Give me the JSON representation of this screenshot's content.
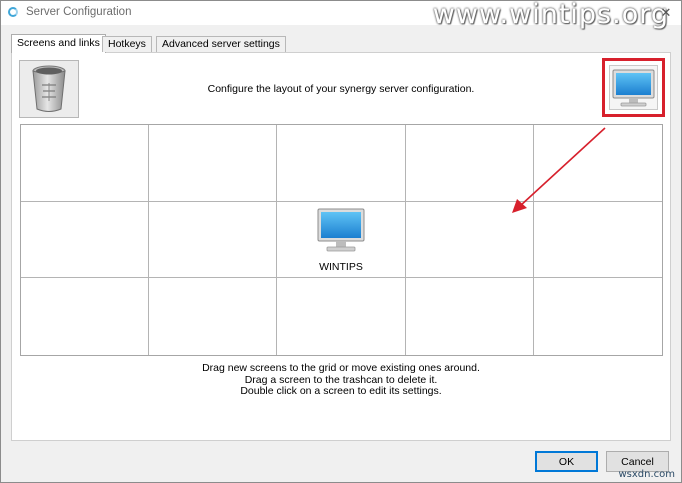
{
  "window": {
    "title": "Server Configuration",
    "watermark": "www.wintips.org"
  },
  "tabs": [
    {
      "label": "Screens and links",
      "active": true
    },
    {
      "label": "Hotkeys",
      "active": false
    },
    {
      "label": "Advanced server settings",
      "active": false
    }
  ],
  "layout": {
    "instruction": "Configure the layout of your synergy server configuration.",
    "grid": {
      "columns": 5,
      "rows": 3,
      "screens": [
        {
          "name": "WINTIPS",
          "row": 1,
          "col": 2
        }
      ]
    },
    "help_lines": [
      "Drag new screens to the grid or move existing ones around.",
      "Drag a screen to the trashcan to delete it.",
      "Double click on a screen to edit its settings."
    ]
  },
  "icons": {
    "trash": "trashcan-icon",
    "new_screen": "monitor-icon",
    "screen": "monitor-icon",
    "close": "close-icon"
  },
  "buttons": {
    "ok": "OK",
    "cancel": "Cancel"
  },
  "footer": {
    "watermark": "wsxdn.com"
  },
  "colors": {
    "highlight": "#d7202c",
    "accent": "#0078d7"
  }
}
